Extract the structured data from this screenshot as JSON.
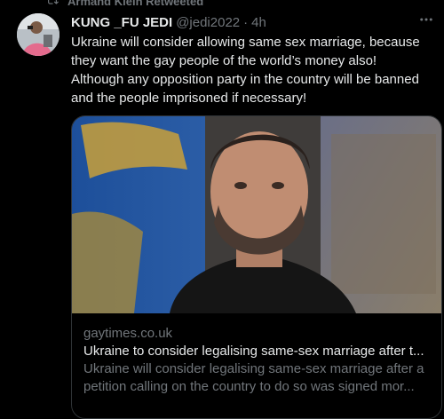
{
  "retweet": {
    "label": "Armand Klein Retweeted"
  },
  "tweet": {
    "display_name": "KUNG _FU JEDI",
    "handle": "@jedi2022",
    "separator": "·",
    "time": "4h",
    "text_lines": [
      "Ukraine will consider allowing same sex marriage, because",
      "they want the gay people of the world’s money also!",
      "Although any opposition party in the country will be banned",
      "and the people imprisoned if necessary!"
    ]
  },
  "card": {
    "domain": "gaytimes.co.uk",
    "title": "Ukraine to consider legalising same-sex marriage after t...",
    "description_lines": [
      "Ukraine will consider legalising same-sex marriage after a",
      "petition calling on the country to do so was signed mor..."
    ]
  },
  "icons": {
    "retweet": "retweet-icon",
    "more": "more-icon"
  },
  "colors": {
    "background": "#000000",
    "text_primary": "#e7e9ea",
    "text_secondary": "#71767b",
    "border": "#2f3336"
  }
}
